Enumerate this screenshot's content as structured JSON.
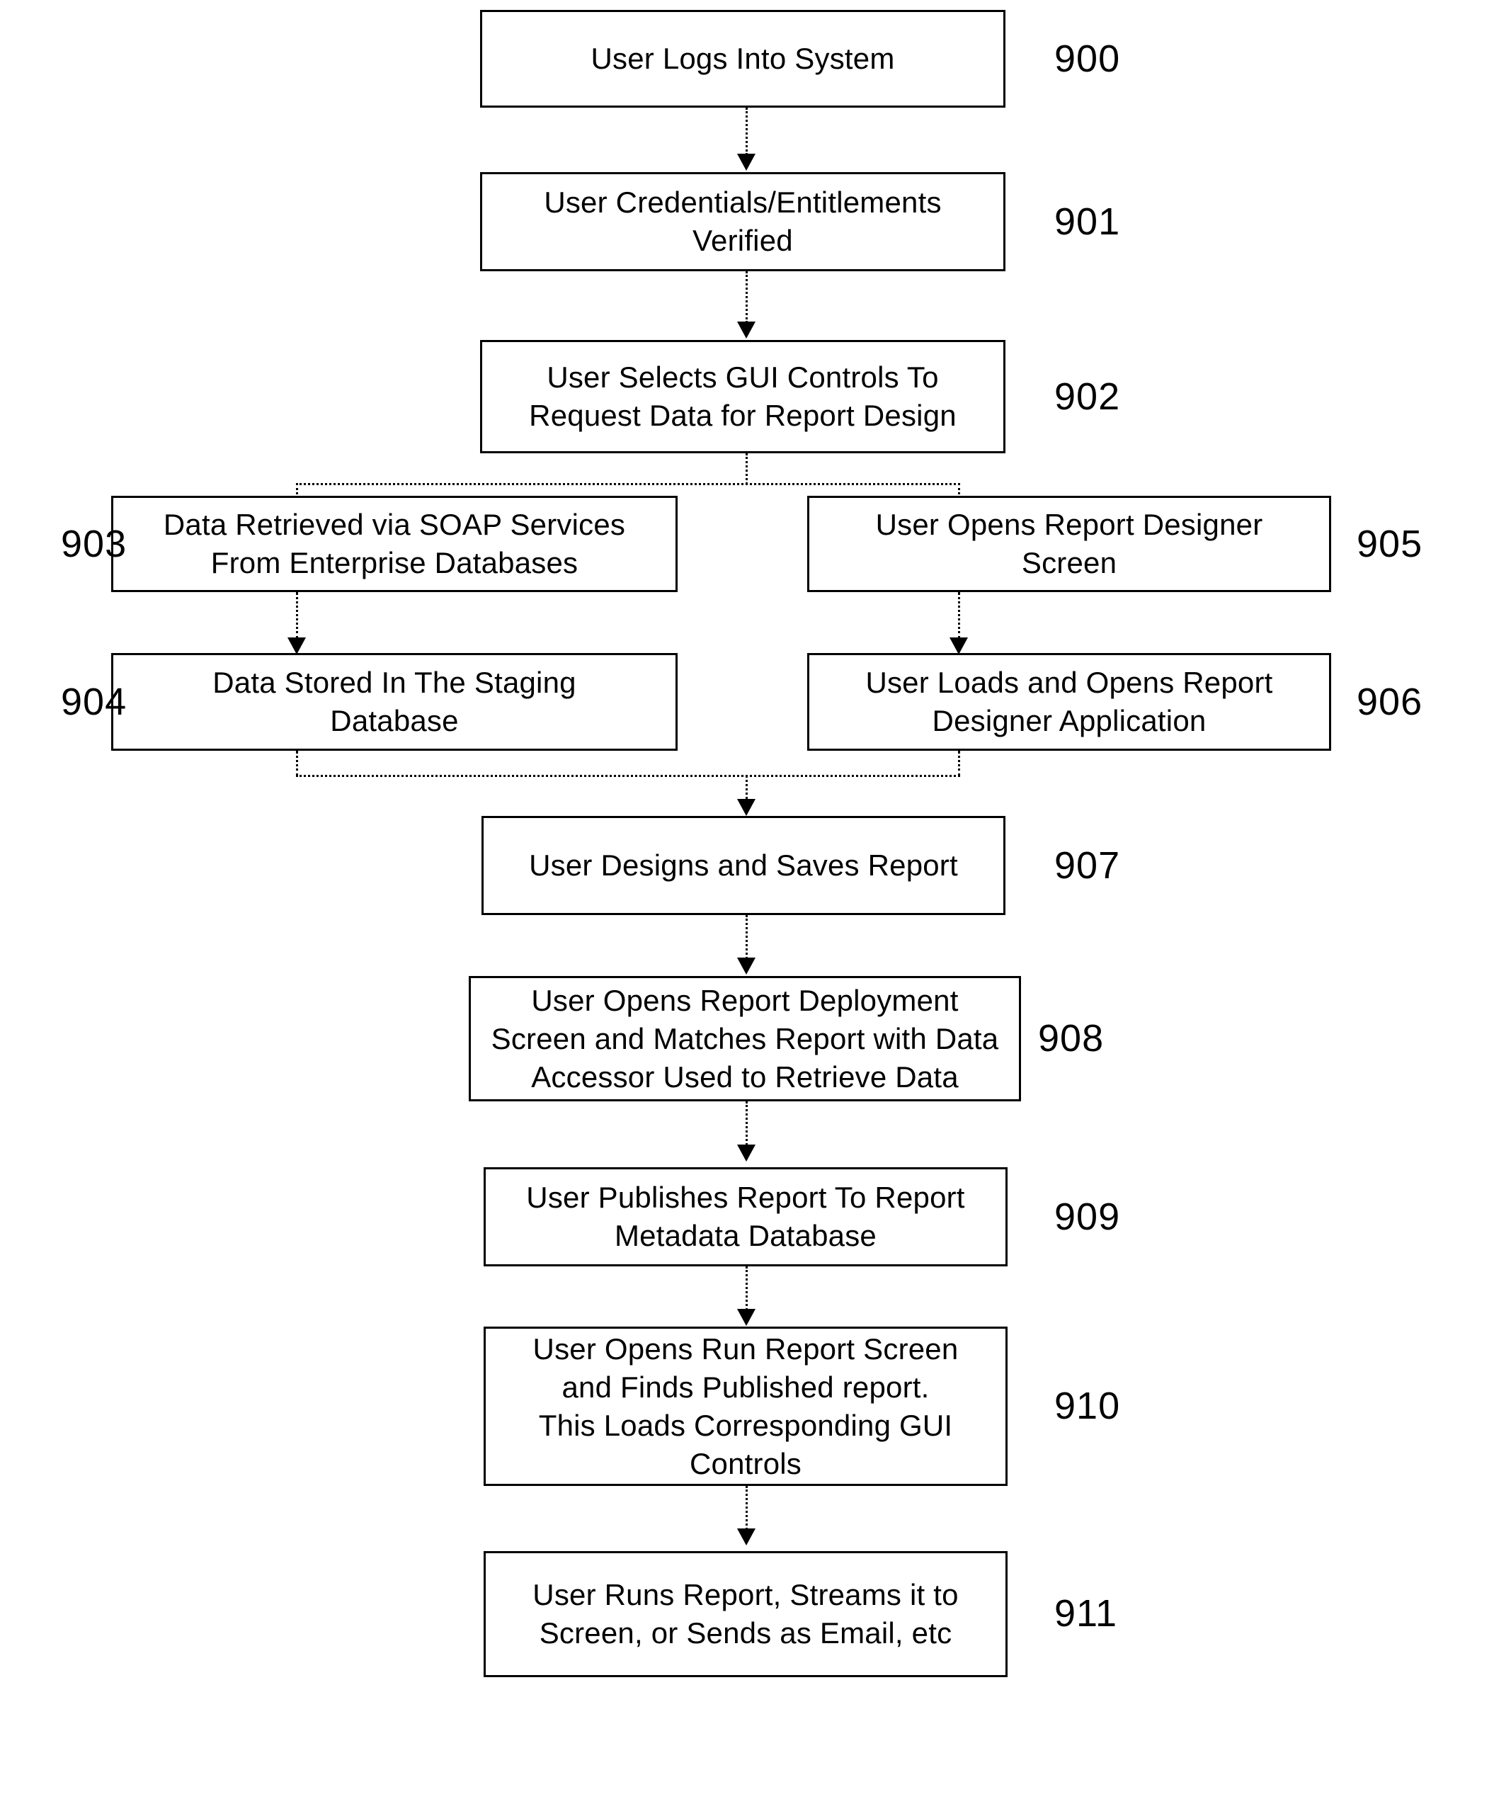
{
  "figure": {
    "type": "flowchart",
    "orientation": "top-to-bottom",
    "connector_style": "dotted-line-with-solid-arrowhead"
  },
  "nodes": [
    {
      "ref": "900",
      "text": "User Logs Into System"
    },
    {
      "ref": "901",
      "text": "User Credentials/Entitlements\nVerified"
    },
    {
      "ref": "902",
      "text": "User Selects GUI Controls To\nRequest Data for Report Design"
    },
    {
      "ref": "903",
      "text": "Data Retrieved via SOAP Services\nFrom Enterprise Databases"
    },
    {
      "ref": "905",
      "text": "User Opens Report Designer\nScreen"
    },
    {
      "ref": "904",
      "text": "Data Stored In The Staging\nDatabase"
    },
    {
      "ref": "906",
      "text": "User Loads and Opens Report\nDesigner Application"
    },
    {
      "ref": "907",
      "text": "User Designs and Saves Report"
    },
    {
      "ref": "908",
      "text": "User Opens Report Deployment\nScreen and Matches Report with Data\nAccessor Used to Retrieve Data"
    },
    {
      "ref": "909",
      "text": "User Publishes Report To Report\nMetadata Database"
    },
    {
      "ref": "910",
      "text": "User Opens Run Report Screen\nand Finds Published report.\nThis Loads Corresponding GUI\nControls"
    },
    {
      "ref": "911",
      "text": "User Runs Report, Streams it to\nScreen, or Sends as Email, etc"
    }
  ],
  "refs": {
    "n900": "900",
    "n901": "901",
    "n902": "902",
    "n903": "903",
    "n904": "904",
    "n905": "905",
    "n906": "906",
    "n907": "907",
    "n908": "908",
    "n909": "909",
    "n910": "910",
    "n911": "911"
  },
  "texts": {
    "n900": "User Logs Into System",
    "n901": "User Credentials/Entitlements\nVerified",
    "n902": "User Selects GUI Controls To\nRequest Data for Report Design",
    "n903": "Data Retrieved via SOAP Services\nFrom Enterprise Databases",
    "n904": "Data Stored In The Staging\nDatabase",
    "n905": "User Opens Report Designer\nScreen",
    "n906": "User Loads and Opens Report\nDesigner Application",
    "n907": "User Designs and Saves Report",
    "n908": "User Opens Report Deployment\nScreen and Matches Report with Data\nAccessor Used to Retrieve Data",
    "n909": "User Publishes Report To Report\nMetadata Database",
    "n910": "User Opens Run Report Screen\nand Finds Published report.\nThis Loads Corresponding GUI\nControls",
    "n911": "User Runs Report, Streams it to\nScreen, or Sends as Email, etc"
  },
  "colors": {
    "background": "#ffffff",
    "stroke": "#000000",
    "text": "#000000"
  }
}
